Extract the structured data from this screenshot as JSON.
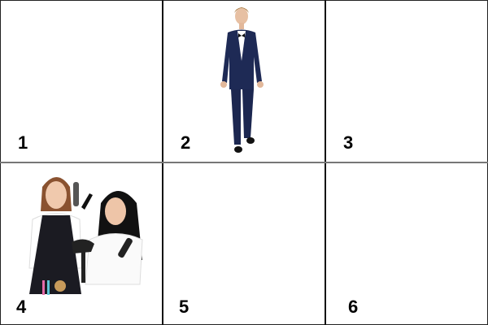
{
  "cells": [
    {
      "label": "1",
      "image": ""
    },
    {
      "label": "2",
      "image": "man-in-navy-tuxedo"
    },
    {
      "label": "3",
      "image": ""
    },
    {
      "label": "4",
      "image": "two-hairdressers-with-brushes-and-dryer"
    },
    {
      "label": "5",
      "image": ""
    },
    {
      "label": "6",
      "image": ""
    }
  ]
}
